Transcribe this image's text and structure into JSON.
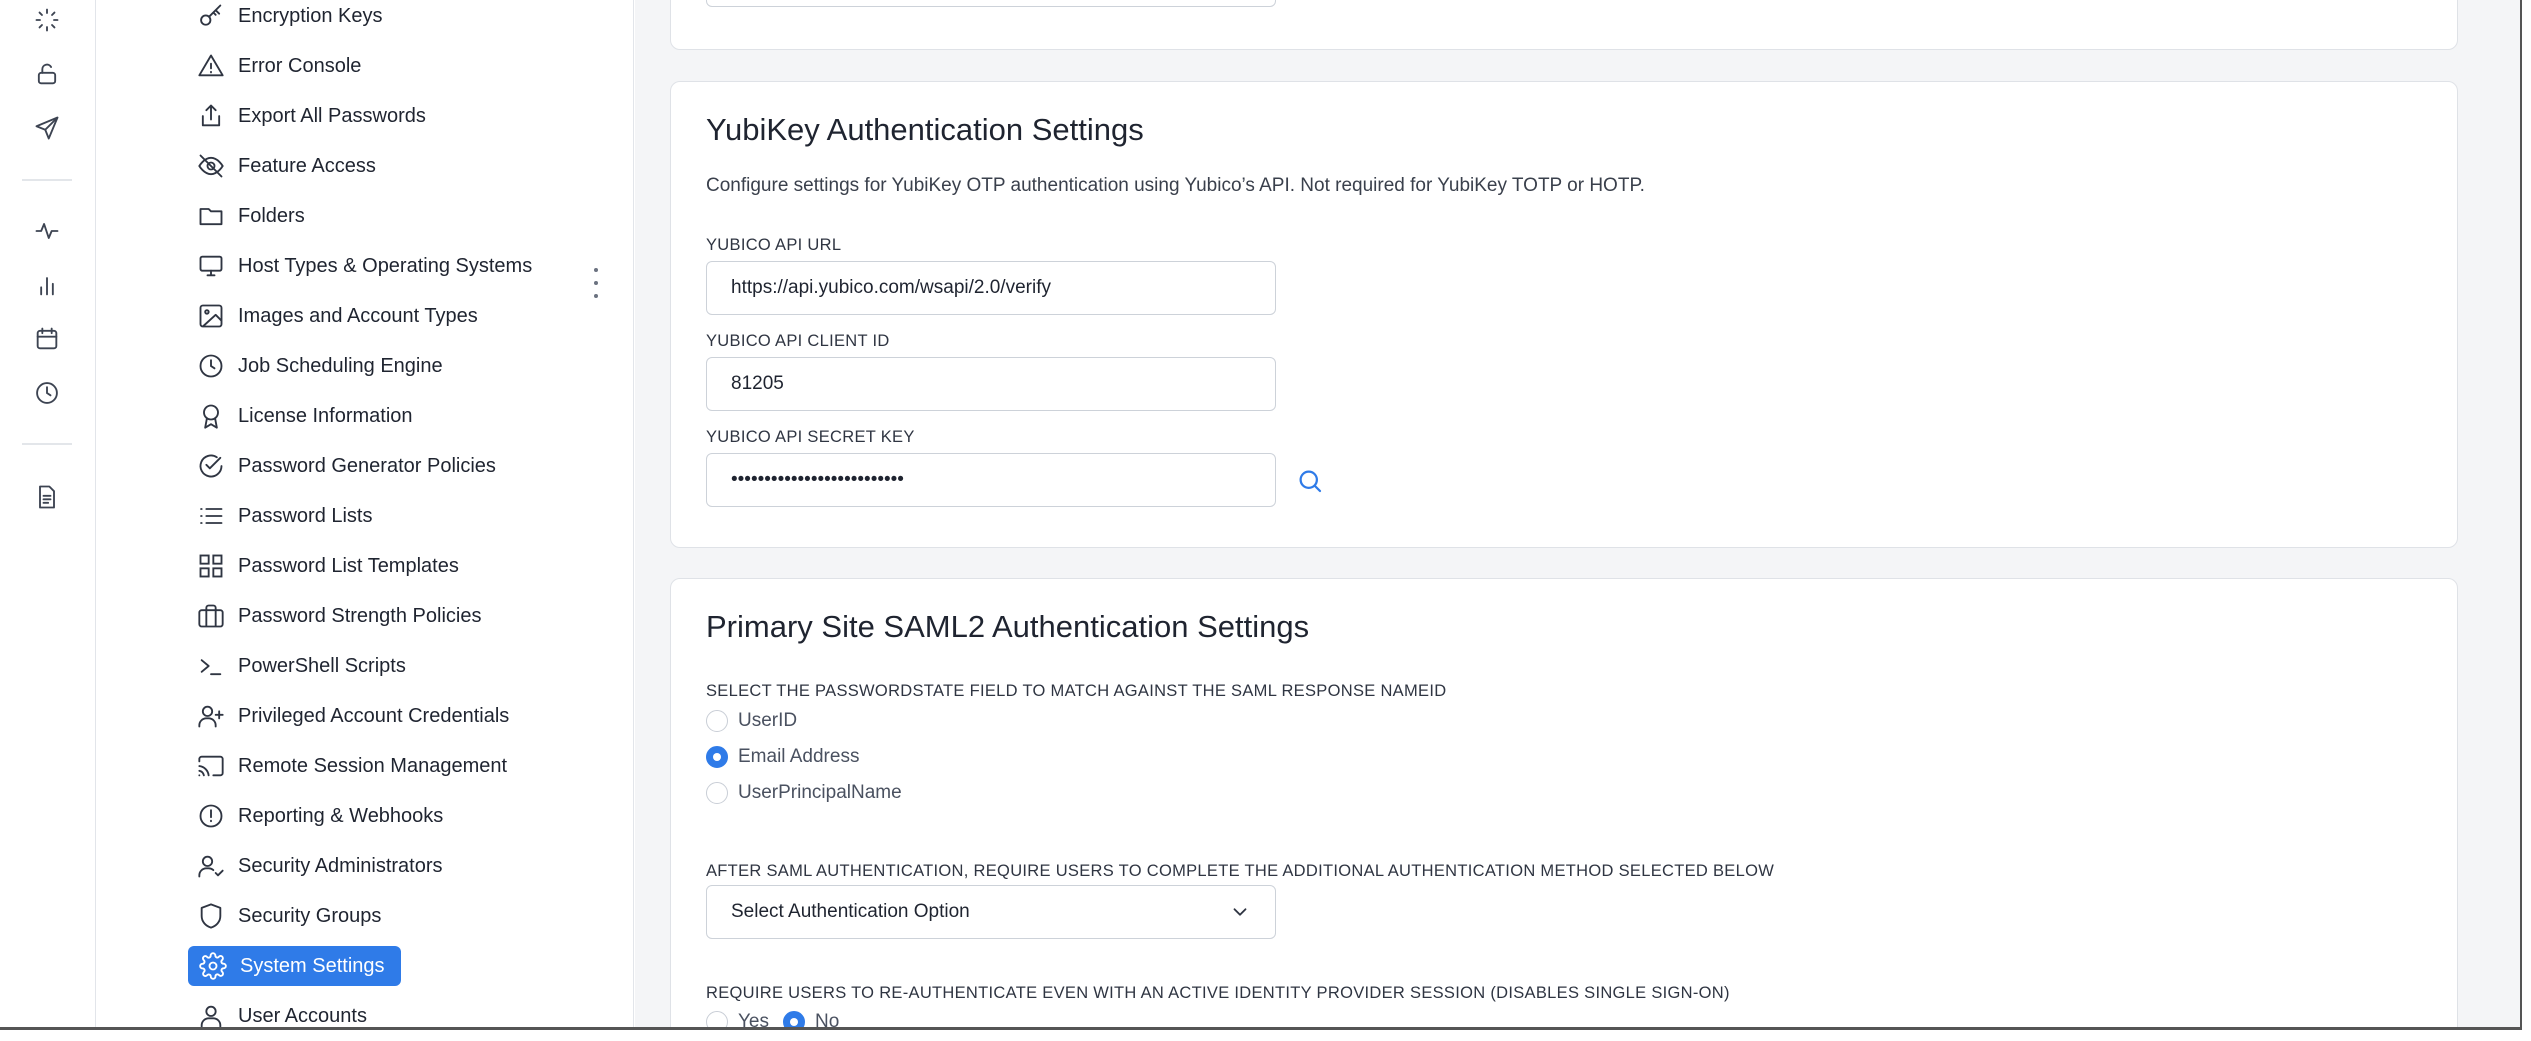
{
  "nav": {
    "items": [
      {
        "label": "Encryption Keys",
        "icon": "key-icon"
      },
      {
        "label": "Error Console",
        "icon": "warning-triangle-icon"
      },
      {
        "label": "Export All Passwords",
        "icon": "export-upload-icon"
      },
      {
        "label": "Feature Access",
        "icon": "eye-off-icon"
      },
      {
        "label": "Folders",
        "icon": "folder-icon"
      },
      {
        "label": "Host Types & Operating Systems",
        "icon": "monitor-icon"
      },
      {
        "label": "Images and Account Types",
        "icon": "image-icon"
      },
      {
        "label": "Job Scheduling Engine",
        "icon": "clock-icon"
      },
      {
        "label": "License Information",
        "icon": "award-ribbon-icon"
      },
      {
        "label": "Password Generator Policies",
        "icon": "check-circle-icon"
      },
      {
        "label": "Password Lists",
        "icon": "list-icon"
      },
      {
        "label": "Password List Templates",
        "icon": "grid-icon"
      },
      {
        "label": "Password Strength Policies",
        "icon": "briefcase-icon"
      },
      {
        "label": "PowerShell Scripts",
        "icon": "terminal-icon"
      },
      {
        "label": "Privileged Account Credentials",
        "icon": "user-plus-icon"
      },
      {
        "label": "Remote Session Management",
        "icon": "cast-icon"
      },
      {
        "label": "Reporting & Webhooks",
        "icon": "alert-circle-icon"
      },
      {
        "label": "Security Administrators",
        "icon": "user-check-icon"
      },
      {
        "label": "Security Groups",
        "icon": "shield-icon"
      },
      {
        "label": "System Settings",
        "icon": "gear-icon",
        "active": true
      },
      {
        "label": "User Accounts",
        "icon": "user-icon"
      }
    ]
  },
  "yubikey": {
    "title": "YubiKey Authentication Settings",
    "description": "Configure settings for YubiKey OTP authentication using Yubico’s API. Not required for YubiKey TOTP or HOTP.",
    "api_url_label": "YUBICO API URL",
    "api_url_value": "https://api.yubico.com/wsapi/2.0/verify",
    "client_id_label": "YUBICO API CLIENT ID",
    "client_id_value": "81205",
    "secret_key_label": "YUBICO API SECRET KEY",
    "secret_key_value": "••••••••••••••••••••••••••"
  },
  "saml": {
    "title": "Primary Site SAML2 Authentication Settings",
    "match_field_label": "SELECT THE PASSWORDSTATE FIELD TO MATCH AGAINST THE SAML RESPONSE NAMEID",
    "match_options": [
      {
        "label": "UserID",
        "selected": false
      },
      {
        "label": "Email Address",
        "selected": true
      },
      {
        "label": "UserPrincipalName",
        "selected": false
      }
    ],
    "additional_auth_label": "AFTER SAML AUTHENTICATION, REQUIRE USERS TO COMPLETE THE ADDITIONAL AUTHENTICATION METHOD SELECTED BELOW",
    "additional_auth_value": "Select Authentication Option",
    "reauth_label": "REQUIRE USERS TO RE-AUTHENTICATE EVEN WITH AN ACTIVE IDENTITY PROVIDER SESSION (DISABLES SINGLE SIGN-ON)",
    "reauth_options": [
      {
        "label": "Yes",
        "selected": false
      },
      {
        "label": "No",
        "selected": true
      }
    ]
  },
  "colors": {
    "accent": "#2f7be8",
    "background": "#f4f5f7"
  }
}
